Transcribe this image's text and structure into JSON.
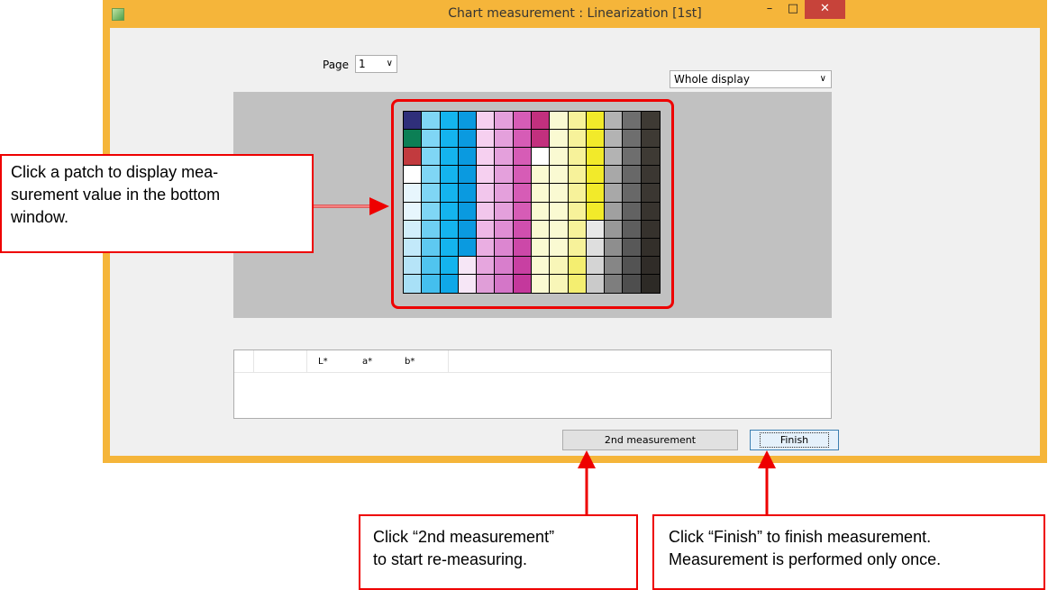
{
  "window": {
    "title": "Chart measurement : Linearization [1st]",
    "minimize_glyph": "–",
    "maximize_glyph": "□",
    "close_glyph": "✕"
  },
  "page_selector": {
    "label": "Page",
    "value": "1"
  },
  "display_selector": {
    "value": "Whole display"
  },
  "results_table": {
    "columns": [
      "",
      "",
      "L*",
      "a*",
      "b*"
    ]
  },
  "buttons": {
    "second_measurement": "2nd measurement",
    "finish": "Finish"
  },
  "patch_chart": {
    "rows": 10,
    "cols": 14,
    "colors": [
      [
        "#2f2f7a",
        "#7fd6f5",
        "#14b4ee",
        "#0a9ae0",
        "#f6d0f0",
        "#e4a0dc",
        "#d65cb6",
        "#c2307e",
        "#fafad2",
        "#f7f29a",
        "#f2ea2a",
        "#b3b3b3",
        "#6e6e6e",
        "#3e3a34"
      ],
      [
        "#0c7f55",
        "#7fd6f5",
        "#14b4ee",
        "#0a9ae0",
        "#f6d0f0",
        "#e4a0dc",
        "#d65cb6",
        "#c2307e",
        "#fafad2",
        "#f7f29a",
        "#f2ea2a",
        "#b3b3b3",
        "#6e6e6e",
        "#3e3a34"
      ],
      [
        "#c23a3e",
        "#7fd6f5",
        "#14b4ee",
        "#0a9ae0",
        "#f6d0f0",
        "#e4a0dc",
        "#d65cb6",
        "#ffffff",
        "#fafad2",
        "#f7f29a",
        "#f2ea2a",
        "#b3b3b3",
        "#6e6e6e",
        "#3e3a34"
      ],
      [
        "#ffffff",
        "#7fd6f5",
        "#14b4ee",
        "#0a9ae0",
        "#f6d0f0",
        "#e4a0dc",
        "#d65cb6",
        "#fafad2",
        "#fafad2",
        "#f7f29a",
        "#f2ea2a",
        "#a8a8a8",
        "#686868",
        "#3b3732"
      ],
      [
        "#e7f6fd",
        "#7fd6f5",
        "#14b4ee",
        "#0a9ae0",
        "#f2c6ec",
        "#e4a0dc",
        "#d65cb6",
        "#fafad2",
        "#fafad2",
        "#f7f29a",
        "#f2ea2a",
        "#a8a8a8",
        "#686868",
        "#3b3732"
      ],
      [
        "#e7f6fd",
        "#7fd6f5",
        "#14b4ee",
        "#0a9ae0",
        "#f2c6ec",
        "#e4a0dc",
        "#d65cb6",
        "#fafad2",
        "#fafad2",
        "#f7f29a",
        "#f2ea2a",
        "#a0a0a0",
        "#626262",
        "#38342f"
      ],
      [
        "#d2effb",
        "#6ecff3",
        "#14b4ee",
        "#0a9ae0",
        "#eeb8e6",
        "#e08ed4",
        "#d04fae",
        "#fafad2",
        "#fafad2",
        "#f7f29a",
        "#e8e8e8",
        "#989898",
        "#5e5e5e",
        "#36322d"
      ],
      [
        "#c2e9fa",
        "#5ec9f1",
        "#14b4ee",
        "#0a9ae0",
        "#eaaee2",
        "#dc86d0",
        "#cc48a8",
        "#fafad2",
        "#fafad2",
        "#f7f29a",
        "#dedede",
        "#8e8e8e",
        "#585858",
        "#332f2a"
      ],
      [
        "#b6e4f8",
        "#50c4ef",
        "#14b4ee",
        "#f6e6f6",
        "#e6a6de",
        "#d87ecc",
        "#c840a2",
        "#fafad2",
        "#f8f6b8",
        "#f4ee70",
        "#d4d4d4",
        "#868686",
        "#535353",
        "#302c28"
      ],
      [
        "#a8e0f7",
        "#44bfee",
        "#0fa8e8",
        "#f6e6f6",
        "#e09ed8",
        "#d476c8",
        "#c4389c",
        "#fafad2",
        "#f8f6b8",
        "#f4ee70",
        "#cacaca",
        "#7e7e7e",
        "#4e4e4e",
        "#2d2a26"
      ]
    ]
  },
  "annotations": {
    "patch_hint": "Click a patch to display mea-\nsurement value in the bottom\nwindow.",
    "second_hint": "Click “2nd measurement”\nto start re-measuring.",
    "finish_hint": "Click “Finish” to finish measurement.\nMeasurement is performed only once."
  }
}
